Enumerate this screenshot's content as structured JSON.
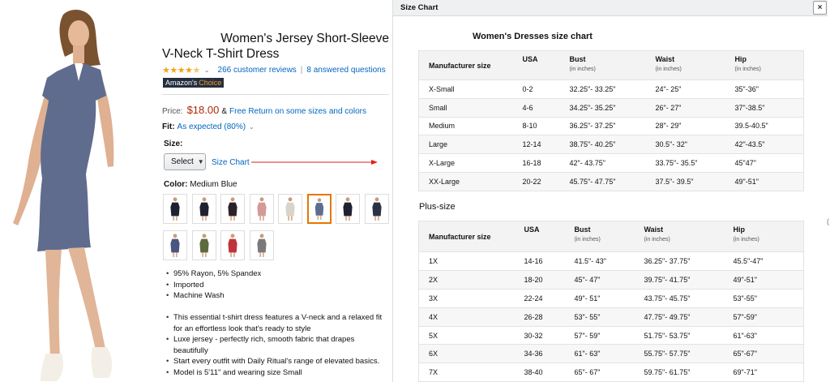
{
  "product": {
    "title_line1": "Women's Jersey Short-Sleeve",
    "title_line2": "V-Neck T-Shirt Dress",
    "rating_stars": 4.5,
    "reviews_link": "266 customer reviews",
    "separator": "|",
    "questions_link": "8 answered questions",
    "badge_part1": "Amazon's",
    "badge_part2": "Choice",
    "price_label": "Price:",
    "price": "$18.00",
    "price_amp": "&",
    "free_return_link": "Free Return on some sizes and colors",
    "fit_label": "Fit:",
    "fit_value": "As expected (80%)",
    "size_label": "Size:",
    "size_select_value": "Select",
    "size_chart_link": "Size Chart",
    "color_label": "Color:",
    "color_value": "Medium Blue",
    "swatch_colors": [
      "#1e2230",
      "#1e2230",
      "#2a2228",
      "#d49a9a",
      "#d9d4c8",
      "#5e6c8d",
      "#1e2230",
      "#2a3345",
      "#4a5580",
      "#5e6a3e",
      "#c0333a",
      "#7a7a7a"
    ],
    "selected_swatch": 6,
    "features": [
      "95% Rayon, 5% Spandex",
      "Imported",
      "Machine Wash"
    ],
    "description": [
      "This essential t-shirt dress features a V-neck and a relaxed fit for an effortless look that's ready to style",
      "Luxe jersey - perfectly rich, smooth fabric that drapes beautifully",
      "Start every outfit with Daily Ritual's range of elevated basics.",
      "Model is 5'11\" and wearing size Small"
    ],
    "dress_color": "#5f6c8e"
  },
  "modal": {
    "title": "Size Chart",
    "close_label": "×",
    "side_handle": "(",
    "table1_title": "Women's Dresses size chart",
    "table2_title": "Plus-size",
    "headers": {
      "manufacturer": "Manufacturer size",
      "usa": "USA",
      "bust": "Bust",
      "waist": "Waist",
      "hip": "Hip",
      "unit": "(in inches)"
    },
    "table1_rows": [
      [
        "X-Small",
        "0-2",
        "32.25\"- 33.25\"",
        "24\"- 25\"",
        "35\"-36\""
      ],
      [
        "Small",
        "4-6",
        "34.25\"- 35.25\"",
        "26\"- 27\"",
        "37\"-38.5\""
      ],
      [
        "Medium",
        "8-10",
        "36.25\"- 37.25\"",
        "28\"- 29\"",
        "39.5-40.5\""
      ],
      [
        "Large",
        "12-14",
        "38.75\"- 40.25\"",
        "30.5\"- 32\"",
        "42\"-43.5\""
      ],
      [
        "X-Large",
        "16-18",
        "42\"- 43.75\"",
        "33.75\"- 35.5\"",
        "45\"47\""
      ],
      [
        "XX-Large",
        "20-22",
        "45.75\"- 47.75\"",
        "37.5\"- 39.5\"",
        "49\"-51\""
      ]
    ],
    "table2_rows": [
      [
        "1X",
        "14-16",
        "41.5\"- 43\"",
        "36.25\"- 37.75\"",
        "45.5\"-47\""
      ],
      [
        "2X",
        "18-20",
        "45\"- 47\"",
        "39.75\"- 41.75\"",
        "49\"-51\""
      ],
      [
        "3X",
        "22-24",
        "49\"- 51\"",
        "43.75\"- 45.75\"",
        "53\"-55\""
      ],
      [
        "4X",
        "26-28",
        "53\"- 55\"",
        "47.75\"- 49.75\"",
        "57\"-59\""
      ],
      [
        "5X",
        "30-32",
        "57\"- 59\"",
        "51.75\"- 53.75\"",
        "61\"-63\""
      ],
      [
        "6X",
        "34-36",
        "61\"- 63\"",
        "55.75\"- 57.75\"",
        "65\"-67\""
      ],
      [
        "7X",
        "38-40",
        "65\"- 67\"",
        "59.75\"- 61.75\"",
        "69\"-71\""
      ]
    ]
  }
}
